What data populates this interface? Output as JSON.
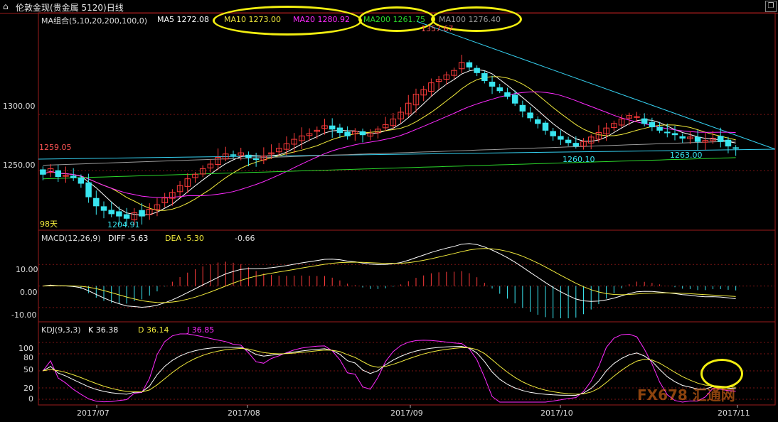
{
  "window": {
    "title": "伦敦金现(贵金属 5120)日线",
    "home_icon": "house-icon"
  },
  "price_panel": {
    "ma_group_label": "MA组合(5,10,20,200,100,0)",
    "ma5": "MA5 1272.08",
    "ma10": "MA10 1273.00",
    "ma20": "MA20 1280.92",
    "ma200": "MA200 1261.75",
    "ma100": "MA100 1276.40",
    "y_ticks": [
      "1300.00",
      "1250.00"
    ],
    "annotations": {
      "high": "1357.67",
      "low": "1204.91",
      "left_value": "1259.05",
      "mid_low": "1260.10",
      "right_low": "1263.00",
      "days": "98天"
    }
  },
  "macd_panel": {
    "label": "MACD(12,26,9)",
    "diff": "DIFF  -5.63",
    "dea": "DEA  -5.30",
    "macd": "-0.66",
    "y_ticks": [
      "10.00",
      "0.00",
      "-10.00"
    ]
  },
  "kdj_panel": {
    "label": "KDJ(9,3,3)",
    "k": "K  36.38",
    "d": "D  36.14",
    "j": "J  36.85",
    "y_ticks": [
      "100",
      "80",
      "50",
      "20",
      "0"
    ]
  },
  "x_axis": [
    "2017/07",
    "2017/08",
    "2017/09",
    "2017/10",
    "2017/11"
  ],
  "watermark": "FX678 汇通网",
  "colors": {
    "up": "#ff3b3b",
    "down": "#39e5ef",
    "ma5": "#ffffff",
    "ma10": "#f1ea3c",
    "ma20": "#ff2aff",
    "ma200": "#2bd92b",
    "ma100": "#9a9a9a",
    "trend": "#35d0f0",
    "highlight": "#f2ee10"
  },
  "chart_data": {
    "type": "candlestick",
    "series_order": "daily closes Jun 29 - Nov 3 2017 (approx.)",
    "close": [
      1247,
      1252,
      1245,
      1246,
      1244,
      1239,
      1227,
      1219,
      1215,
      1212,
      1210,
      1208,
      1213,
      1210,
      1216,
      1220,
      1226,
      1231,
      1237,
      1243,
      1247,
      1252,
      1256,
      1262,
      1265,
      1264,
      1266,
      1262,
      1260,
      1263,
      1266,
      1270,
      1274,
      1278,
      1281,
      1283,
      1286,
      1290,
      1287,
      1284,
      1281,
      1285,
      1282,
      1283,
      1287,
      1291,
      1296,
      1302,
      1310,
      1318,
      1322,
      1328,
      1331,
      1335,
      1339,
      1346,
      1342,
      1337,
      1330,
      1325,
      1321,
      1316,
      1310,
      1303,
      1297,
      1292,
      1286,
      1281,
      1278,
      1275,
      1272,
      1276,
      1280,
      1284,
      1288,
      1292,
      1296,
      1299,
      1298,
      1292,
      1289,
      1286,
      1284,
      1282,
      1279,
      1280,
      1276,
      1277,
      1279,
      1276,
      1272,
      1270
    ],
    "high": 1357.67,
    "low": 1204.91,
    "ma": {
      "ma5": 1272.08,
      "ma10": 1273.0,
      "ma20": 1280.92,
      "ma200": 1261.75,
      "ma100": 1276.4
    },
    "ylim": [
      1200,
      1380
    ],
    "macd": {
      "diff": -5.63,
      "dea": -5.3,
      "macd": -0.66,
      "ylim": [
        -15,
        20
      ]
    },
    "kdj": {
      "k": 36.38,
      "d": 36.14,
      "j": 36.85,
      "ylim": [
        -5,
        115
      ]
    }
  }
}
